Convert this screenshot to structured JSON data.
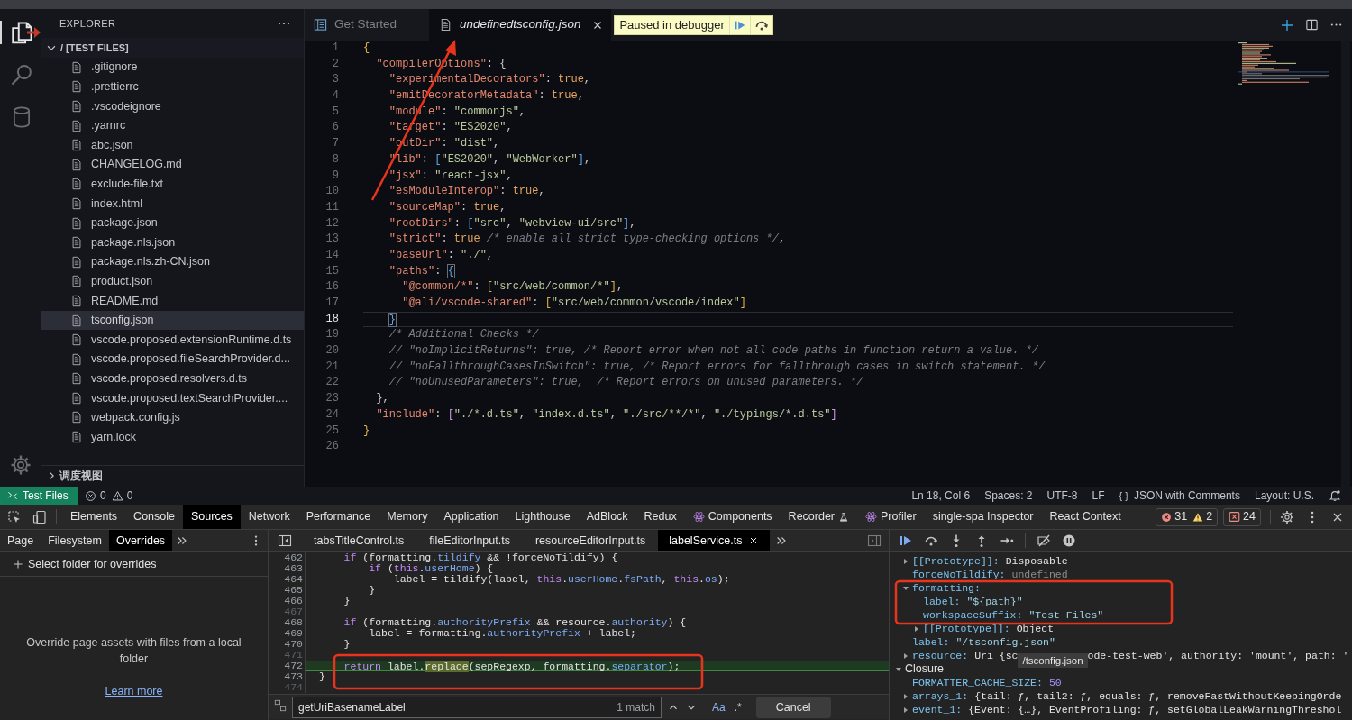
{
  "activity_bar": {
    "items": [
      {
        "kind": "explorer",
        "selected": true
      },
      {
        "kind": "search",
        "selected": false
      },
      {
        "kind": "database",
        "selected": false
      }
    ]
  },
  "sidebar": {
    "title": "EXPLORER",
    "folder": {
      "label": "/ [TEST FILES]",
      "expanded": true
    },
    "files": [
      {
        "name": ".gitignore",
        "selected": false
      },
      {
        "name": ".prettierrc",
        "selected": false
      },
      {
        "name": ".vscodeignore",
        "selected": false
      },
      {
        "name": ".yarnrc",
        "selected": false
      },
      {
        "name": "abc.json",
        "selected": false
      },
      {
        "name": "CHANGELOG.md",
        "selected": false
      },
      {
        "name": "exclude-file.txt",
        "selected": false
      },
      {
        "name": "index.html",
        "selected": false
      },
      {
        "name": "package.json",
        "selected": false
      },
      {
        "name": "package.nls.json",
        "selected": false
      },
      {
        "name": "package.nls.zh-CN.json",
        "selected": false
      },
      {
        "name": "product.json",
        "selected": false
      },
      {
        "name": "README.md",
        "selected": false
      },
      {
        "name": "tsconfig.json",
        "selected": true
      },
      {
        "name": "vscode.proposed.extensionRuntime.d.ts",
        "selected": false
      },
      {
        "name": "vscode.proposed.fileSearchProvider.d...",
        "selected": false
      },
      {
        "name": "vscode.proposed.resolvers.d.ts",
        "selected": false
      },
      {
        "name": "vscode.proposed.textSearchProvider....",
        "selected": false
      },
      {
        "name": "webpack.config.js",
        "selected": false
      },
      {
        "name": "yarn.lock",
        "selected": false
      }
    ],
    "section": {
      "label": "调度视图",
      "expanded": false
    }
  },
  "editor": {
    "tabs": [
      {
        "label": "Get Started",
        "kind": "welcome",
        "selected": false,
        "preview": false
      },
      {
        "label": "undefinedtsconfig.json",
        "kind": "file",
        "selected": true,
        "preview": true
      }
    ],
    "debug_toolbar": {
      "label": "Paused in debugger"
    },
    "lines": [
      {
        "num": "1",
        "current": false,
        "tokens": [
          {
            "kind": "g",
            "text": "{"
          }
        ]
      },
      {
        "num": "2",
        "current": false,
        "tokens": [
          {
            "kind": "k",
            "text": "  \"compilerOptions\""
          },
          {
            "kind": "p",
            "text": ": {"
          }
        ]
      },
      {
        "num": "3",
        "current": false,
        "tokens": [
          {
            "kind": "k",
            "text": "    \"experimentalDecorators\""
          },
          {
            "kind": "p",
            "text": ": "
          },
          {
            "kind": "b",
            "text": "true"
          },
          {
            "kind": "p",
            "text": ","
          }
        ]
      },
      {
        "num": "4",
        "current": false,
        "tokens": [
          {
            "kind": "k",
            "text": "    \"emitDecoratorMetadata\""
          },
          {
            "kind": "p",
            "text": ": "
          },
          {
            "kind": "b",
            "text": "true"
          },
          {
            "kind": "p",
            "text": ","
          }
        ]
      },
      {
        "num": "5",
        "current": false,
        "tokens": [
          {
            "kind": "k",
            "text": "    \"module\""
          },
          {
            "kind": "p",
            "text": ": "
          },
          {
            "kind": "s",
            "text": "\"commonjs\""
          },
          {
            "kind": "p",
            "text": ","
          }
        ]
      },
      {
        "num": "6",
        "current": false,
        "tokens": [
          {
            "kind": "k",
            "text": "    \"target\""
          },
          {
            "kind": "p",
            "text": ": "
          },
          {
            "kind": "s",
            "text": "\"ES2020\""
          },
          {
            "kind": "p",
            "text": ","
          }
        ]
      },
      {
        "num": "7",
        "current": false,
        "tokens": [
          {
            "kind": "k",
            "text": "    \"outDir\""
          },
          {
            "kind": "p",
            "text": ": "
          },
          {
            "kind": "s",
            "text": "\"dist\""
          },
          {
            "kind": "p",
            "text": ","
          }
        ]
      },
      {
        "num": "8",
        "current": false,
        "tokens": [
          {
            "kind": "k",
            "text": "    \"lib\""
          },
          {
            "kind": "p",
            "text": ": "
          },
          {
            "kind": "bl",
            "text": "["
          },
          {
            "kind": "s",
            "text": "\"ES2020\""
          },
          {
            "kind": "p",
            "text": ", "
          },
          {
            "kind": "s",
            "text": "\"WebWorker\""
          },
          {
            "kind": "bl",
            "text": "]"
          },
          {
            "kind": "p",
            "text": ","
          }
        ]
      },
      {
        "num": "9",
        "current": false,
        "tokens": [
          {
            "kind": "k",
            "text": "    \"jsx\""
          },
          {
            "kind": "p",
            "text": ": "
          },
          {
            "kind": "s",
            "text": "\"react-jsx\""
          },
          {
            "kind": "p",
            "text": ","
          }
        ]
      },
      {
        "num": "10",
        "current": false,
        "tokens": [
          {
            "kind": "k",
            "text": "    \"esModuleInterop\""
          },
          {
            "kind": "p",
            "text": ": "
          },
          {
            "kind": "b",
            "text": "true"
          },
          {
            "kind": "p",
            "text": ","
          }
        ]
      },
      {
        "num": "11",
        "current": false,
        "tokens": [
          {
            "kind": "k",
            "text": "    \"sourceMap\""
          },
          {
            "kind": "p",
            "text": ": "
          },
          {
            "kind": "b",
            "text": "true"
          },
          {
            "kind": "p",
            "text": ","
          }
        ]
      },
      {
        "num": "12",
        "current": false,
        "tokens": [
          {
            "kind": "k",
            "text": "    \"rootDirs\""
          },
          {
            "kind": "p",
            "text": ": "
          },
          {
            "kind": "bl",
            "text": "["
          },
          {
            "kind": "s",
            "text": "\"src\""
          },
          {
            "kind": "p",
            "text": ", "
          },
          {
            "kind": "s",
            "text": "\"webview-ui/src\""
          },
          {
            "kind": "bl",
            "text": "]"
          },
          {
            "kind": "p",
            "text": ","
          }
        ]
      },
      {
        "num": "13",
        "current": false,
        "tokens": [
          {
            "kind": "k",
            "text": "    \"strict\""
          },
          {
            "kind": "p",
            "text": ": "
          },
          {
            "kind": "b",
            "text": "true"
          },
          {
            "kind": "c",
            "text": " /* enable all strict type-checking options */"
          },
          {
            "kind": "p",
            "text": ","
          }
        ]
      },
      {
        "num": "14",
        "current": false,
        "tokens": [
          {
            "kind": "k",
            "text": "    \"baseUrl\""
          },
          {
            "kind": "p",
            "text": ": "
          },
          {
            "kind": "s",
            "text": "\"./\""
          },
          {
            "kind": "p",
            "text": ","
          }
        ]
      },
      {
        "num": "15",
        "current": false,
        "tokens": [
          {
            "kind": "k",
            "text": "    \"paths\""
          },
          {
            "kind": "p",
            "text": ": "
          },
          {
            "kind": "bm",
            "text": "{"
          }
        ]
      },
      {
        "num": "16",
        "current": false,
        "tokens": [
          {
            "kind": "k",
            "text": "      \"@common/*\""
          },
          {
            "kind": "p",
            "text": ": "
          },
          {
            "kind": "g",
            "text": "["
          },
          {
            "kind": "s",
            "text": "\"src/web/common/*\""
          },
          {
            "kind": "g",
            "text": "]"
          },
          {
            "kind": "p",
            "text": ","
          }
        ]
      },
      {
        "num": "17",
        "current": false,
        "tokens": [
          {
            "kind": "k",
            "text": "      \"@ali/vscode-shared\""
          },
          {
            "kind": "p",
            "text": ": "
          },
          {
            "kind": "g",
            "text": "["
          },
          {
            "kind": "s",
            "text": "\"src/web/common/vscode/index\""
          },
          {
            "kind": "g",
            "text": "]"
          }
        ]
      },
      {
        "num": "18",
        "current": true,
        "tokens": [
          {
            "kind": "bm",
            "text": "    }"
          }
        ]
      },
      {
        "num": "19",
        "current": false,
        "tokens": [
          {
            "kind": "c",
            "text": "    /* Additional Checks */"
          }
        ]
      },
      {
        "num": "20",
        "current": false,
        "tokens": [
          {
            "kind": "c",
            "text": "    // \"noImplicitReturns\": true, /* Report error when not all code paths in function return a value. */"
          }
        ]
      },
      {
        "num": "21",
        "current": false,
        "tokens": [
          {
            "kind": "c",
            "text": "    // \"noFallthroughCasesInSwitch\": true, /* Report errors for fallthrough cases in switch statement. */"
          }
        ]
      },
      {
        "num": "22",
        "current": false,
        "tokens": [
          {
            "kind": "c",
            "text": "    // \"noUnusedParameters\": true,  /* Report errors on unused parameters. */"
          }
        ]
      },
      {
        "num": "23",
        "current": false,
        "tokens": [
          {
            "kind": "p",
            "text": "  },"
          }
        ]
      },
      {
        "num": "24",
        "current": false,
        "tokens": [
          {
            "kind": "k",
            "text": "  \"include\""
          },
          {
            "kind": "p",
            "text": ": "
          },
          {
            "kind": "v",
            "text": "["
          },
          {
            "kind": "s",
            "text": "\"./*.d.ts\""
          },
          {
            "kind": "p",
            "text": ", "
          },
          {
            "kind": "s",
            "text": "\"index.d.ts\""
          },
          {
            "kind": "p",
            "text": ", "
          },
          {
            "kind": "s",
            "text": "\"./src/**/*\""
          },
          {
            "kind": "p",
            "text": ", "
          },
          {
            "kind": "s",
            "text": "\"./typings/*.d.ts\""
          },
          {
            "kind": "v",
            "text": "]"
          }
        ]
      },
      {
        "num": "25",
        "current": false,
        "tokens": [
          {
            "kind": "g",
            "text": "}"
          }
        ]
      },
      {
        "num": "26",
        "current": false
      }
    ]
  },
  "status_bar": {
    "remote": "Test Files",
    "errors": "0",
    "warnings": "0",
    "items": [
      "Ln 18, Col 6",
      "Spaces: 2",
      "UTF-8",
      "LF"
    ],
    "language_braces": "{ }",
    "language": "JSON with Comments",
    "layout": "Layout: U.S."
  },
  "devtools": {
    "tabs": [
      {
        "label": "Elements",
        "kind": "plain",
        "selected": false
      },
      {
        "label": "Console",
        "kind": "plain",
        "selected": false
      },
      {
        "label": "Sources",
        "kind": "plain",
        "selected": true
      },
      {
        "label": "Network",
        "kind": "plain",
        "selected": false
      },
      {
        "label": "Performance",
        "kind": "plain",
        "selected": false
      },
      {
        "label": "Memory",
        "kind": "plain",
        "selected": false
      },
      {
        "label": "Application",
        "kind": "plain",
        "selected": false
      },
      {
        "label": "Lighthouse",
        "kind": "plain",
        "selected": false
      },
      {
        "label": "AdBlock",
        "kind": "plain",
        "selected": false
      },
      {
        "label": "Redux",
        "kind": "plain",
        "selected": false
      },
      {
        "label": "Components",
        "kind": "react",
        "selected": false
      },
      {
        "label": "Recorder",
        "kind": "recorder",
        "selected": false
      },
      {
        "label": "Profiler",
        "kind": "react",
        "selected": false
      },
      {
        "label": "single-spa Inspector",
        "kind": "plain",
        "selected": false
      },
      {
        "label": "React Context",
        "kind": "plain",
        "selected": false
      }
    ],
    "issues": {
      "errors": "31",
      "warnings": "2",
      "blocked": "24"
    },
    "navigator_tabs": [
      {
        "label": "Page",
        "selected": false
      },
      {
        "label": "Filesystem",
        "selected": false
      },
      {
        "label": "Overrides",
        "selected": true
      }
    ],
    "overrides": {
      "add": "Select folder for overrides",
      "message": "Override page assets with files from a local folder",
      "link": "Learn more"
    },
    "file_tabs": [
      {
        "label": "tabsTitleControl.ts",
        "selected": false
      },
      {
        "label": "fileEditorInput.ts",
        "selected": false
      },
      {
        "label": "resourceEditorInput.ts",
        "selected": false
      },
      {
        "label": "labelService.ts",
        "selected": true
      }
    ],
    "code": [
      {
        "num": "462",
        "paused": false,
        "tokens": [
          {
            "kind": "kw",
            "text": "    if"
          },
          {
            "kind": "p",
            "text": " (formatting."
          },
          {
            "kind": "pr",
            "text": "tildify"
          },
          {
            "kind": "p",
            "text": " && !forceNoTildify) {"
          }
        ]
      },
      {
        "num": "463",
        "paused": false,
        "tokens": [
          {
            "kind": "kw",
            "text": "        if"
          },
          {
            "kind": "p",
            "text": " ("
          },
          {
            "kind": "kw",
            "text": "this"
          },
          {
            "kind": "p",
            "text": "."
          },
          {
            "kind": "pr",
            "text": "userHome"
          },
          {
            "kind": "p",
            "text": ") {"
          }
        ]
      },
      {
        "num": "464",
        "paused": false,
        "tokens": [
          {
            "kind": "p",
            "text": "            label = tildify(label, "
          },
          {
            "kind": "kw",
            "text": "this"
          },
          {
            "kind": "p",
            "text": "."
          },
          {
            "kind": "pr",
            "text": "userHome"
          },
          {
            "kind": "p",
            "text": "."
          },
          {
            "kind": "pr",
            "text": "fsPath"
          },
          {
            "kind": "p",
            "text": ", "
          },
          {
            "kind": "kw",
            "text": "this"
          },
          {
            "kind": "p",
            "text": "."
          },
          {
            "kind": "pr",
            "text": "os"
          },
          {
            "kind": "p",
            "text": ");"
          }
        ]
      },
      {
        "num": "465",
        "paused": false,
        "tokens": [
          {
            "kind": "p",
            "text": "        }"
          }
        ]
      },
      {
        "num": "466",
        "paused": false,
        "tokens": [
          {
            "kind": "p",
            "text": "    }"
          }
        ]
      },
      {
        "num": "467",
        "paused": false
      },
      {
        "num": "468",
        "paused": false,
        "tokens": [
          {
            "kind": "kw",
            "text": "    if"
          },
          {
            "kind": "p",
            "text": " (formatting."
          },
          {
            "kind": "pr",
            "text": "authorityPrefix"
          },
          {
            "kind": "p",
            "text": " && resource."
          },
          {
            "kind": "pr",
            "text": "authority"
          },
          {
            "kind": "p",
            "text": ") {"
          }
        ]
      },
      {
        "num": "469",
        "paused": false,
        "tokens": [
          {
            "kind": "p",
            "text": "        label = formatting."
          },
          {
            "kind": "pr",
            "text": "authorityPrefix"
          },
          {
            "kind": "p",
            "text": " + label;"
          }
        ]
      },
      {
        "num": "470",
        "paused": false,
        "tokens": [
          {
            "kind": "p",
            "text": "    }"
          }
        ]
      },
      {
        "num": "471",
        "paused": false
      },
      {
        "num": "472",
        "paused": true,
        "tokens": [
          {
            "kind": "kw",
            "text": "    return"
          },
          {
            "kind": "p",
            "text": " label."
          },
          {
            "kind": "m",
            "text": "replace"
          },
          {
            "kind": "p",
            "text": "(sepRegexp, formatting."
          },
          {
            "kind": "pr",
            "text": "separator"
          },
          {
            "kind": "p",
            "text": ");"
          }
        ]
      },
      {
        "num": "473",
        "paused": false,
        "tokens": [
          {
            "kind": "p",
            "text": "}"
          }
        ]
      },
      {
        "num": "474",
        "paused": false
      }
    ],
    "search": {
      "value": "getUriBasenameLabel",
      "matches": "1 match",
      "case": "Aa",
      "regex": ".*",
      "cancel": "Cancel"
    },
    "scope": [
      {
        "key": "[[Prototype]]:",
        "value": "Disposable",
        "kind": "object",
        "expandable": true,
        "expanded": false
      },
      {
        "key": "forceNoTildify:",
        "value": "undefined",
        "kind": "undefined"
      },
      {
        "key": "formatting:",
        "expandable": true,
        "expanded": true,
        "children": [
          {
            "key": "label:",
            "value": "\"${path}\"",
            "kind": "string"
          },
          {
            "key": "workspaceSuffix:",
            "value": "\"Test Files\"",
            "kind": "string"
          },
          {
            "key": "[[Prototype]]:",
            "value": "Object",
            "kind": "object",
            "expandable": true,
            "expanded": false
          }
        ]
      },
      {
        "key": "label:",
        "value": "\"/tsconfig.json\"",
        "kind": "string"
      },
      {
        "key": "resource:",
        "value": "Uri {sc",
        "tooltip": "/tsconfig.json",
        "value_after": "ode-test-web', authority: 'mount', path: '",
        "kind": "object",
        "expandable": true,
        "expanded": false
      }
    ],
    "closure": {
      "label": "Closure",
      "expanded": true,
      "children": [
        {
          "key": "FORMATTER_CACHE_SIZE:",
          "value": "50",
          "kind": "number"
        },
        {
          "key": "arrays_1:",
          "value": "{tail: ƒ, tail2: ƒ, equals: ƒ, removeFastWithoutKeepingOrde",
          "kind": "object",
          "expandable": true,
          "expanded": false
        },
        {
          "key": "event_1:",
          "value": "{Event: {…}, EventProfiling: ƒ, setGlobalLeakWarningThreshol",
          "kind": "object",
          "expandable": true,
          "expanded": false
        }
      ]
    }
  }
}
